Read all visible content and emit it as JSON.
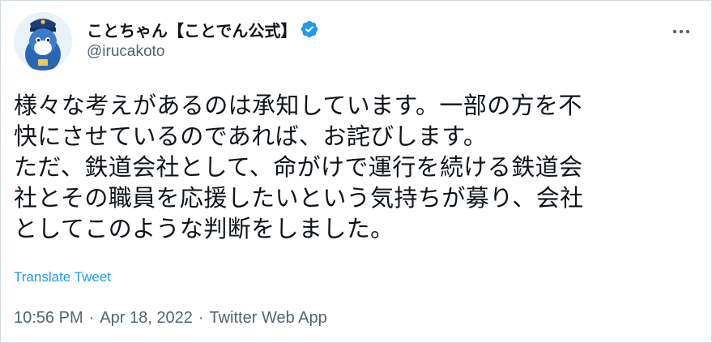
{
  "tweet": {
    "display_name": "ことちゃん【ことでん公式】",
    "handle": "@irucakoto",
    "verified": true,
    "text_lines": [
      "様々な考えがあるのは承知しています。一部の方を不",
      "快にさせているのであれば、お詫びします。",
      "ただ、鉄道会社として、命がけで運行を続ける鉄道会",
      "社とその職員を応援したいという気持ちが募り、会社",
      "としてこのような判断をしました。"
    ],
    "translate_label": "Translate Tweet",
    "time": "10:56 PM",
    "separator": "·",
    "date": "Apr 18, 2022",
    "source": "Twitter Web App"
  },
  "colors": {
    "accent": "#1d9bf0",
    "secondary_text": "#536471",
    "primary_text": "#0f1419",
    "border": "#cfd9de"
  },
  "icons": {
    "verified": "verified-badge-icon",
    "more": "more-horizontal-icon",
    "avatar": "dolphin-mascot-avatar"
  }
}
